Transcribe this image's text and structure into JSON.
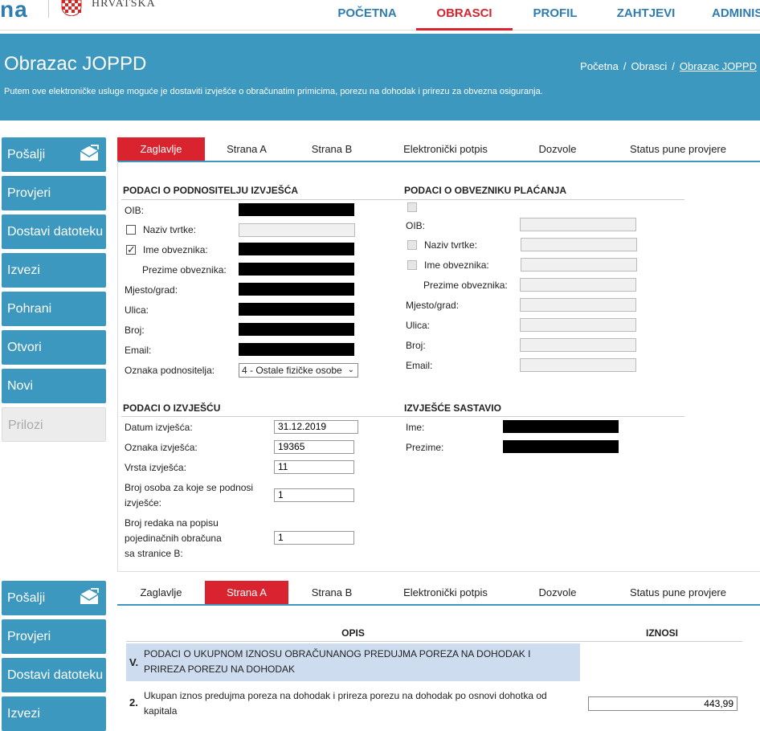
{
  "header": {
    "logo_text": "HRVATSKA",
    "logo_fragment": "na",
    "nav": [
      {
        "label": "POČETNA",
        "active": false
      },
      {
        "label": "OBRASCI",
        "active": true
      },
      {
        "label": "PROFIL",
        "active": false
      },
      {
        "label": "ZAHTJEVI",
        "active": false
      },
      {
        "label": "ADMINIS",
        "active": false
      }
    ]
  },
  "banner": {
    "title": "Obrazac JOPPD",
    "breadcrumb": [
      "Početna",
      "Obrasci",
      "Obrazac JOPPD"
    ],
    "description": "Putem ove elektroničke usluge moguće je dostaviti izvješće o obračunatim primicima, porezu na dohodak i prirezu za obvezna osiguranja."
  },
  "sidebar": {
    "items": [
      "Pošalji",
      "Provjeri",
      "Dostavi datoteku",
      "Izvezi",
      "Pohrani",
      "Otvori",
      "Novi",
      "Prilozi"
    ],
    "items2": [
      "Pošalji",
      "Provjeri",
      "Dostavi datoteku",
      "Izvezi"
    ]
  },
  "tabs": [
    "Zaglavlje",
    "Strana A",
    "Strana B",
    "Elektronički potpis",
    "Dozvole",
    "Status pune provjere"
  ],
  "podnositelj": {
    "title": "PODACI O PODNOSITELJU IZVJEŠĆA",
    "labels": {
      "oib": "OIB:",
      "naziv": "Naziv tvrtke:",
      "ime": "Ime obveznika:",
      "prezime": "Prezime obveznika:",
      "mjesto": "Mjesto/grad:",
      "ulica": "Ulica:",
      "broj": "Broj:",
      "email": "Email:",
      "oznaka": "Oznaka podnositelja:"
    },
    "oznaka_value": "4 - Ostale fizičke osobe"
  },
  "obveznik": {
    "title": "PODACI O OBVEZNIKU PLAĆANJA",
    "labels": {
      "oib": "OIB:",
      "naziv": "Naziv tvrtke:",
      "ime": "Ime obveznika:",
      "prezime": "Prezime obveznika:",
      "mjesto": "Mjesto/grad:",
      "ulica": "Ulica:",
      "broj": "Broj:",
      "email": "Email:"
    }
  },
  "izvjesce": {
    "title": "PODACI O IZVJEŠĆU",
    "datum_label": "Datum izvješća:",
    "datum_value": "31.12.2019",
    "oznaka_label": "Oznaka izvješća:",
    "oznaka_value": "19365",
    "vrsta_label": "Vrsta izvješća:",
    "vrsta_value": "11",
    "broj_osoba_label_1": "Broj osoba za koje se podnosi",
    "broj_osoba_label_2": "izvješće:",
    "broj_osoba_value": "1",
    "broj_redaka_label_1": "Broj redaka na popisu",
    "broj_redaka_label_2": "pojedinačnih obračuna",
    "broj_redaka_label_3": "sa stranice B:",
    "broj_redaka_value": "1"
  },
  "sastavio": {
    "title": "IZVJEŠĆE SASTAVIO",
    "ime_label": "Ime:",
    "prezime_label": "Prezime:"
  },
  "strana_a": {
    "col_opis": "OPIS",
    "col_iznosi": "IZNOSI",
    "section_num": "V.",
    "section_text_1": "PODACI O UKUPNOM IZNOSU OBRAČUNANOG PREDUJMA POREZA NA DOHODAK I",
    "section_text_2": "PRIREZA POREZU NA DOHODAK",
    "row_num": "2.",
    "row_text_1": "Ukupan iznos predujma poreza na dohodak i prireza porezu na dohodak po osnovi dohotka od",
    "row_text_2": "kapitala",
    "row_value": "443,99"
  },
  "colors": {
    "accent": "#3d98bf",
    "active": "#d9232e",
    "section_bg": "#cddcef"
  }
}
